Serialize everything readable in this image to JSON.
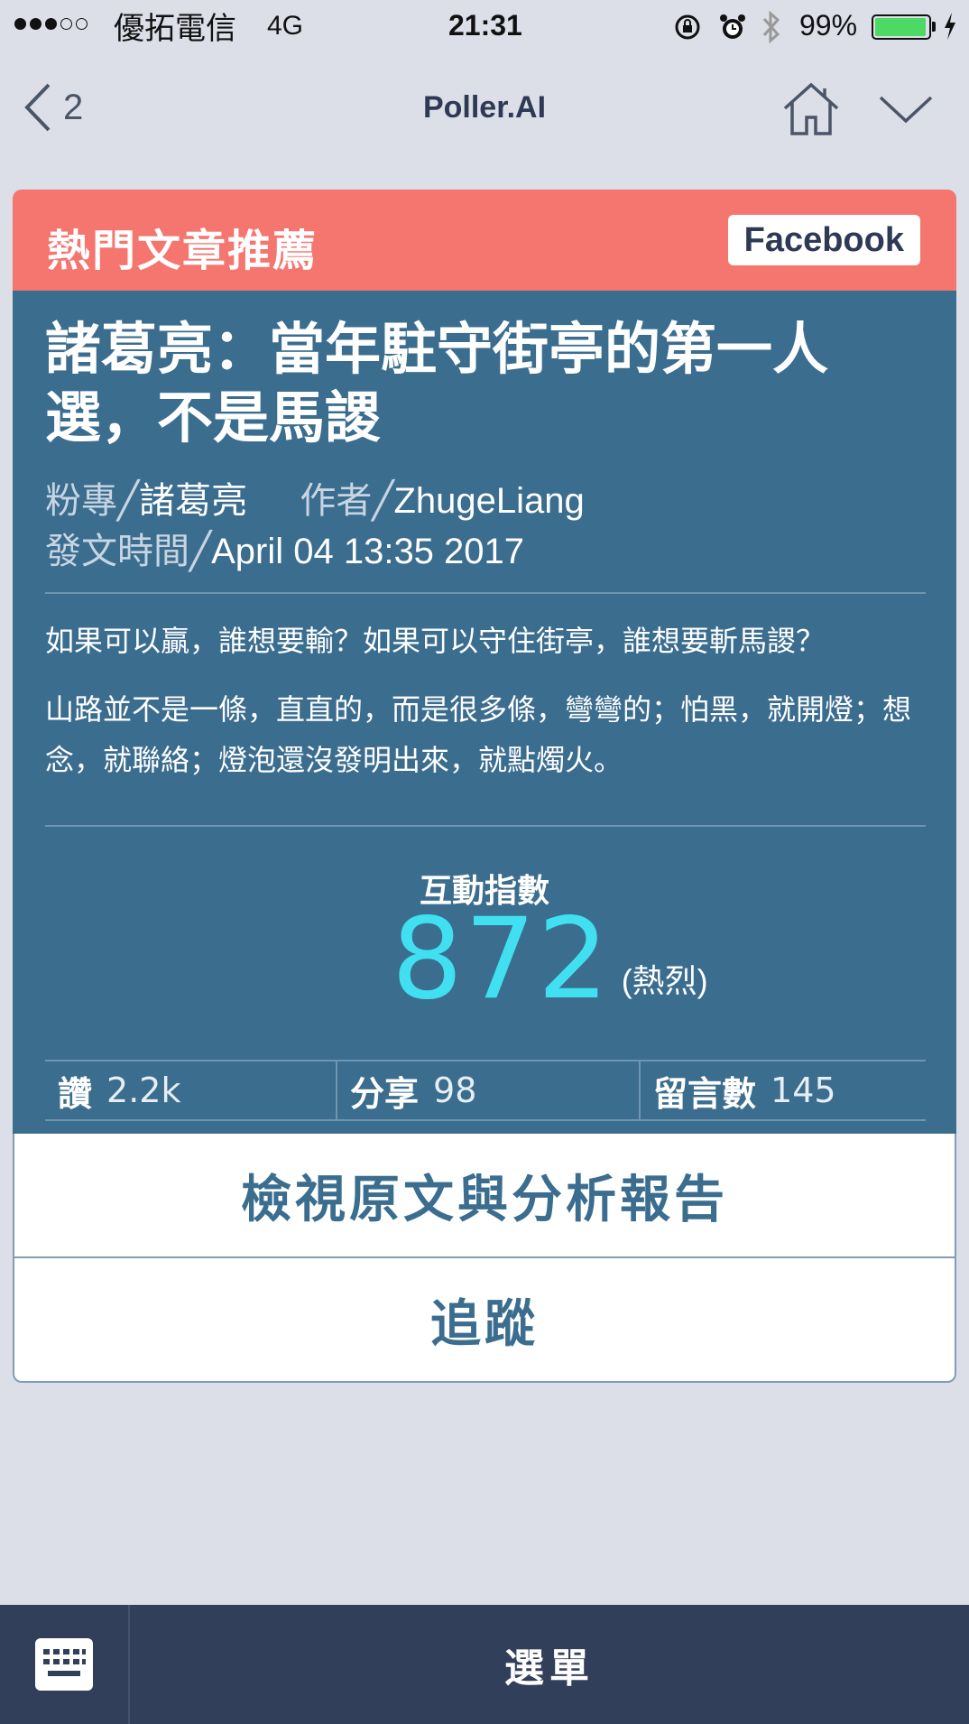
{
  "status_bar": {
    "carrier": "優拓電信",
    "network": "4G",
    "time": "21:31",
    "battery": "99%",
    "battery_level": 0.99,
    "signal_bars_filled": 3,
    "signal_bars_total": 5
  },
  "nav": {
    "back_count": "2",
    "title": "Poller.AI",
    "icons": [
      "chevron-left-icon",
      "home-icon",
      "chevron-down-icon"
    ]
  },
  "card": {
    "header_title": "熱門文章推薦",
    "source": "Facebook",
    "header_color": "#f5756f",
    "body_color": "#3b6d8f",
    "post_title": "諸葛亮：當年駐守街亭的第一人選，不是馬謖",
    "page_label": "粉專╱",
    "page_value": "諸葛亮",
    "author_label": "作者╱",
    "author_value": "ZhugeLiang",
    "time_label": "發文時間╱",
    "time_value": "April 04 13:35 2017",
    "excerpt_1": "如果可以贏，誰想要輸？如果可以守住街亭，誰想要斬馬謖？",
    "excerpt_2": "山路並不是一條，直直的，而是很多條，彎彎的；怕黑，就開燈；想念，就聯絡；燈泡還沒發明出來，就點燭火。",
    "score_label": "互動指數",
    "score_value": "872",
    "score_level": "(熱烈)",
    "stats": [
      {
        "label": "讚",
        "value": "2.2k"
      },
      {
        "label": "分享",
        "value": "98"
      },
      {
        "label": "留言數",
        "value": "145"
      }
    ],
    "view_button": "檢視原文與分析報告",
    "follow_button": "追蹤"
  },
  "bottom_bar": {
    "keyboard_icon": "keyboard-icon",
    "menu_label": "選單"
  }
}
